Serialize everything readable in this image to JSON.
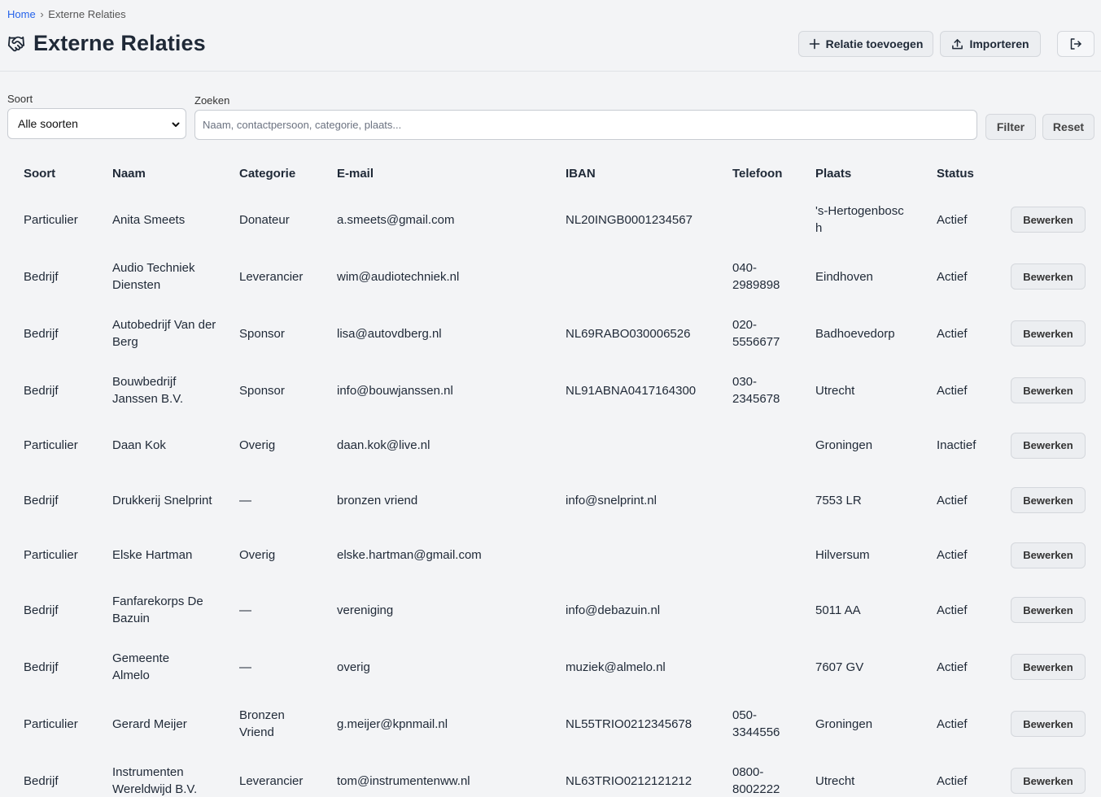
{
  "breadcrumb": {
    "home": "Home",
    "separator": "›",
    "current": "Externe Relaties"
  },
  "page": {
    "title": "Externe Relaties",
    "title_icon": "handshake-icon"
  },
  "actions": {
    "add_label": "Relatie toevoegen",
    "import_label": "Importeren",
    "logout_icon": "logout-icon"
  },
  "filters": {
    "soort_label": "Soort",
    "soort_value": "Alle soorten",
    "zoeken_label": "Zoeken",
    "zoeken_placeholder": "Naam, contactpersoon, categorie, plaats...",
    "filter_label": "Filter",
    "reset_label": "Reset"
  },
  "table": {
    "headers": [
      "Soort",
      "Naam",
      "Categorie",
      "E-mail",
      "IBAN",
      "Telefoon",
      "Plaats",
      "Status",
      ""
    ],
    "edit_label": "Bewerken",
    "rows": [
      {
        "soort": "Particulier",
        "naam": "Anita Smeets",
        "categorie": "Donateur",
        "email": "a.smeets@gmail.com",
        "iban": "NL20INGB0001234567",
        "telefoon": "",
        "plaats": "'s-Hertogenbosch",
        "status": "Actief"
      },
      {
        "soort": "Bedrijf",
        "naam": "Audio Techniek Diensten",
        "categorie": "Leverancier",
        "email": "wim@audiotechniek.nl",
        "iban": "",
        "telefoon": "040-2989898",
        "plaats": "Eindhoven",
        "status": "Actief"
      },
      {
        "soort": "Bedrijf",
        "naam": "Autobedrijf Van der Berg",
        "categorie": "Sponsor",
        "email": "lisa@autovdberg.nl",
        "iban": "NL69RABO030006526",
        "telefoon": "020-5556677",
        "plaats": "Badhoevedorp",
        "status": "Actief"
      },
      {
        "soort": "Bedrijf",
        "naam": "Bouwbedrijf Janssen B.V.",
        "categorie": "Sponsor",
        "email": "info@bouwjanssen.nl",
        "iban": "NL91ABNA0417164300",
        "telefoon": "030-2345678",
        "plaats": "Utrecht",
        "status": "Actief"
      },
      {
        "soort": "Particulier",
        "naam": "Daan Kok",
        "categorie": "Overig",
        "email": "daan.kok@live.nl",
        "iban": "",
        "telefoon": "",
        "plaats": "Groningen",
        "status": "Inactief"
      },
      {
        "soort": "Bedrijf",
        "naam": "Drukkerij Snelprint",
        "categorie": "—",
        "email": "bronzen vriend",
        "iban": "info@snelprint.nl",
        "telefoon": "",
        "plaats": "7553 LR",
        "status": "Actief"
      },
      {
        "soort": "Particulier",
        "naam": "Elske Hartman",
        "categorie": "Overig",
        "email": "elske.hartman@gmail.com",
        "iban": "",
        "telefoon": "",
        "plaats": "Hilversum",
        "status": "Actief"
      },
      {
        "soort": "Bedrijf",
        "naam": "Fanfarekorps De Bazuin",
        "categorie": "—",
        "email": "vereniging",
        "iban": "info@debazuin.nl",
        "telefoon": "",
        "plaats": "5011 AA",
        "status": "Actief"
      },
      {
        "soort": "Bedrijf",
        "naam": "Gemeente Almelo",
        "categorie": "—",
        "email": "overig",
        "iban": "muziek@almelo.nl",
        "telefoon": "",
        "plaats": "7607 GV",
        "status": "Actief"
      },
      {
        "soort": "Particulier",
        "naam": "Gerard Meijer",
        "categorie": "Bronzen Vriend",
        "email": "g.meijer@kpnmail.nl",
        "iban": "NL55TRIO0212345678",
        "telefoon": "050-3344556",
        "plaats": "Groningen",
        "status": "Actief"
      },
      {
        "soort": "Bedrijf",
        "naam": "Instrumenten Wereldwijd B.V.",
        "categorie": "Leverancier",
        "email": "tom@instrumentenww.nl",
        "iban": "NL63TRIO0212121212",
        "telefoon": "0800-8002222",
        "plaats": "Utrecht",
        "status": "Actief"
      }
    ]
  }
}
